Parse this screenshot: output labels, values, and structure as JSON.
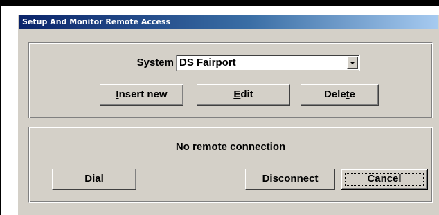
{
  "dialog": {
    "title": "Setup And Monitor Remote Access"
  },
  "system_group": {
    "label": "System",
    "selected_system": "DS Fairport",
    "buttons": {
      "insert_new": {
        "pre": "",
        "accel": "I",
        "post": "nsert new"
      },
      "edit": {
        "pre": "",
        "accel": "E",
        "post": "dit"
      },
      "delete": {
        "pre": "Dele",
        "accel": "t",
        "post": "e"
      }
    }
  },
  "connection_group": {
    "status": "No remote connection",
    "buttons": {
      "dial": {
        "pre": "",
        "accel": "D",
        "post": "ial"
      },
      "disconnect": {
        "pre": "Disco",
        "accel": "n",
        "post": "nect"
      },
      "cancel": {
        "pre": "",
        "accel": "C",
        "post": "ancel"
      }
    }
  },
  "icons": {
    "combo_arrow": "chevron-down-icon"
  },
  "colors": {
    "titlebar_start": "#0a246a",
    "titlebar_end": "#a6caf0",
    "face": "#d4d0c8"
  }
}
